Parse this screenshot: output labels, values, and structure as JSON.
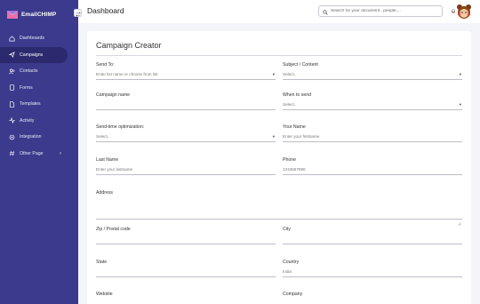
{
  "brand": {
    "name": "EmailCHIMP"
  },
  "sidebar": {
    "items": [
      {
        "label": "Dashboards",
        "icon": "home-icon"
      },
      {
        "label": "Campaigns",
        "icon": "send-icon",
        "active": true
      },
      {
        "label": "Contacts",
        "icon": "users-icon"
      },
      {
        "label": "Forms",
        "icon": "file-icon"
      },
      {
        "label": "Templates",
        "icon": "document-icon"
      },
      {
        "label": "Activity",
        "icon": "activity-icon"
      },
      {
        "label": "Integration",
        "icon": "gear-icon"
      },
      {
        "label": "Other Page",
        "icon": "hash-icon",
        "has_children": true
      }
    ]
  },
  "header": {
    "title": "Dashboard",
    "search_placeholder": "Search for your document , people,..."
  },
  "card": {
    "title": "Campaign Creator",
    "fields": {
      "send_to": {
        "label": "Send To:",
        "placeholder": "Enter list name or choose from list"
      },
      "subject": {
        "label": "Subject / Content",
        "value": "Select.."
      },
      "campaign_name": {
        "label": "Campaign name",
        "value": ""
      },
      "when_to_send": {
        "label": "When to send",
        "value": "Select.."
      },
      "send_time": {
        "label": "Send-time optimization:",
        "value": "Select.."
      },
      "your_name": {
        "label": "Your Name",
        "placeholder": "Enter your firstname"
      },
      "last_name": {
        "label": "Last Name",
        "placeholder": "Enter your lastname"
      },
      "phone": {
        "label": "Phone",
        "value": "1234567890"
      },
      "address": {
        "label": "Address",
        "value": ""
      },
      "zip": {
        "label": "Zip / Postal code",
        "value": ""
      },
      "city": {
        "label": "City",
        "value": ""
      },
      "state": {
        "label": "State",
        "value": ""
      },
      "country": {
        "label": "Country",
        "value": "India"
      },
      "website": {
        "label": "Website",
        "value": ""
      },
      "company": {
        "label": "Company",
        "value": ""
      }
    }
  },
  "colors": {
    "sidebar": "#3b3a8c",
    "active": "#2b2a6e"
  }
}
